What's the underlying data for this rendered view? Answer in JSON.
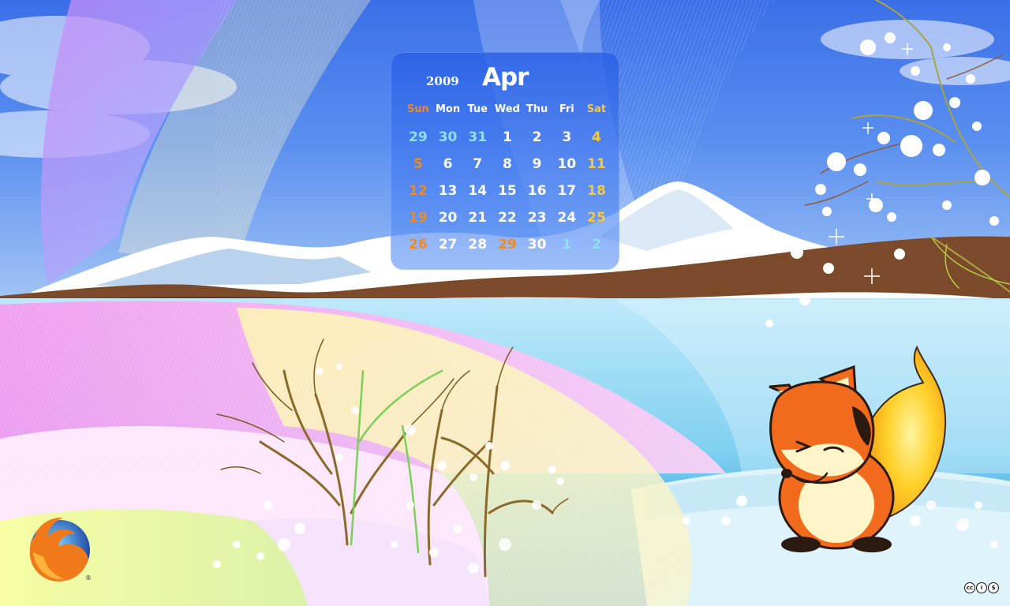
{
  "calendar": {
    "year": "2009",
    "month": "Apr",
    "weekdays": [
      "Sun",
      "Mon",
      "Tue",
      "Wed",
      "Thu",
      "Fri",
      "Sat"
    ],
    "weeks": [
      [
        "29",
        "30",
        "31",
        "1",
        "2",
        "3",
        "4"
      ],
      [
        "5",
        "6",
        "7",
        "8",
        "9",
        "10",
        "11"
      ],
      [
        "12",
        "13",
        "14",
        "15",
        "16",
        "17",
        "18"
      ],
      [
        "19",
        "20",
        "21",
        "22",
        "23",
        "24",
        "25"
      ],
      [
        "26",
        "27",
        "28",
        "29",
        "30",
        "1",
        "2"
      ]
    ]
  },
  "registered_mark": "®",
  "colors": {
    "sunday": "#f08a20",
    "saturday": "#f5c93a",
    "other_month": "#8ee0f2",
    "panel": "#2f62e6"
  },
  "icons": [
    "firefox-logo",
    "fox-mascot",
    "creative-commons-badge"
  ]
}
